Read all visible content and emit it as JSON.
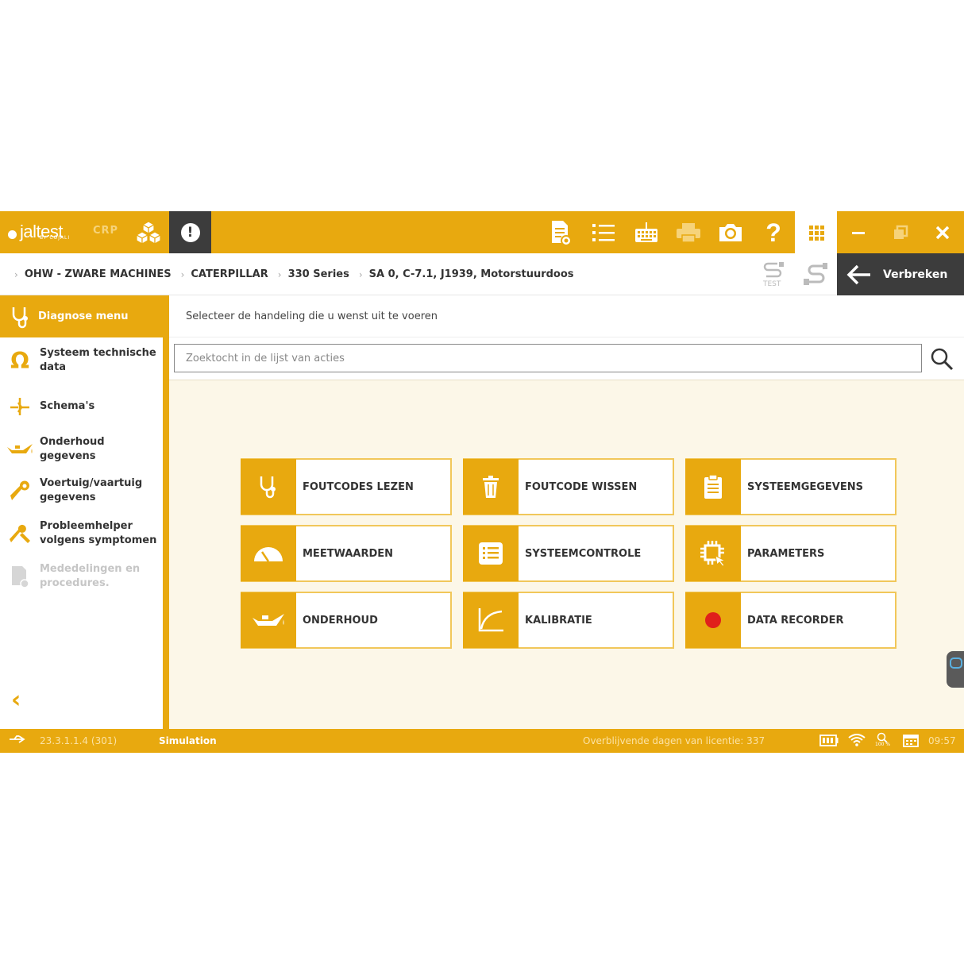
{
  "topbar": {
    "logo_text": "jaltest",
    "logo_sub": "BY COJALI",
    "brand": "CRP",
    "icons": [
      "boxes-icon",
      "alert-icon",
      "report-icon",
      "list-icon",
      "keyboard-icon",
      "printer-icon",
      "camera-icon",
      "help-icon",
      "apps-grid-icon",
      "minimize-icon",
      "restore-icon",
      "close-icon"
    ],
    "alert_glyph": "!",
    "help_glyph": "?"
  },
  "breadcrumb": {
    "items": [
      "OHW - ZWARE MACHINES",
      "CATERPILLAR",
      "330 Series",
      "SA 0, C-7.1, J1939, Motorstuurdoos"
    ],
    "separator": "›"
  },
  "connection": {
    "test_label": "TEST",
    "disconnect_label": "Verbreken"
  },
  "sidebar": {
    "header": "Diagnose menu",
    "items": [
      {
        "label": "Systeem technische data",
        "icon": "omega-icon",
        "enabled": true
      },
      {
        "label": "Schema's",
        "icon": "schema-icon",
        "enabled": true
      },
      {
        "label": "Onderhoud gegevens",
        "icon": "oil-can-icon",
        "enabled": true
      },
      {
        "label": "Voertuig/vaartuig gegevens",
        "icon": "wrench-icon",
        "enabled": true
      },
      {
        "label": "Probleemhelper volgens symptomen",
        "icon": "tools-icon",
        "enabled": true
      },
      {
        "label": "Mededelingen en procedures.",
        "icon": "document-icon",
        "enabled": false
      }
    ],
    "back_glyph": "‹"
  },
  "main": {
    "instruction": "Selecteer de handeling die u wenst uit te voeren",
    "search_placeholder": "Zoektocht in de lijst van acties",
    "tiles": [
      {
        "label": "FOUTCODES LEZEN",
        "icon": "stethoscope-icon"
      },
      {
        "label": "FOUTCODE WISSEN",
        "icon": "trash-icon"
      },
      {
        "label": "SYSTEEMGEGEVENS",
        "icon": "clipboard-icon"
      },
      {
        "label": "MEETWAARDEN",
        "icon": "gauge-icon"
      },
      {
        "label": "SYSTEEMCONTROLE",
        "icon": "checklist-icon"
      },
      {
        "label": "PARAMETERS",
        "icon": "chip-icon"
      },
      {
        "label": "ONDERHOUD",
        "icon": "oil-can-icon"
      },
      {
        "label": "KALIBRATIE",
        "icon": "curve-icon"
      },
      {
        "label": "DATA RECORDER",
        "icon": "record-icon"
      }
    ]
  },
  "statusbar": {
    "version": "23.3.1.1.4 (301)",
    "mode": "Simulation",
    "license": "Overblijvende dagen van licentie: 337",
    "zoom": "100 %",
    "time": "09:57"
  },
  "colors": {
    "accent": "#e8a90f",
    "dark": "#3c3c3c",
    "record": "#e0201b"
  }
}
